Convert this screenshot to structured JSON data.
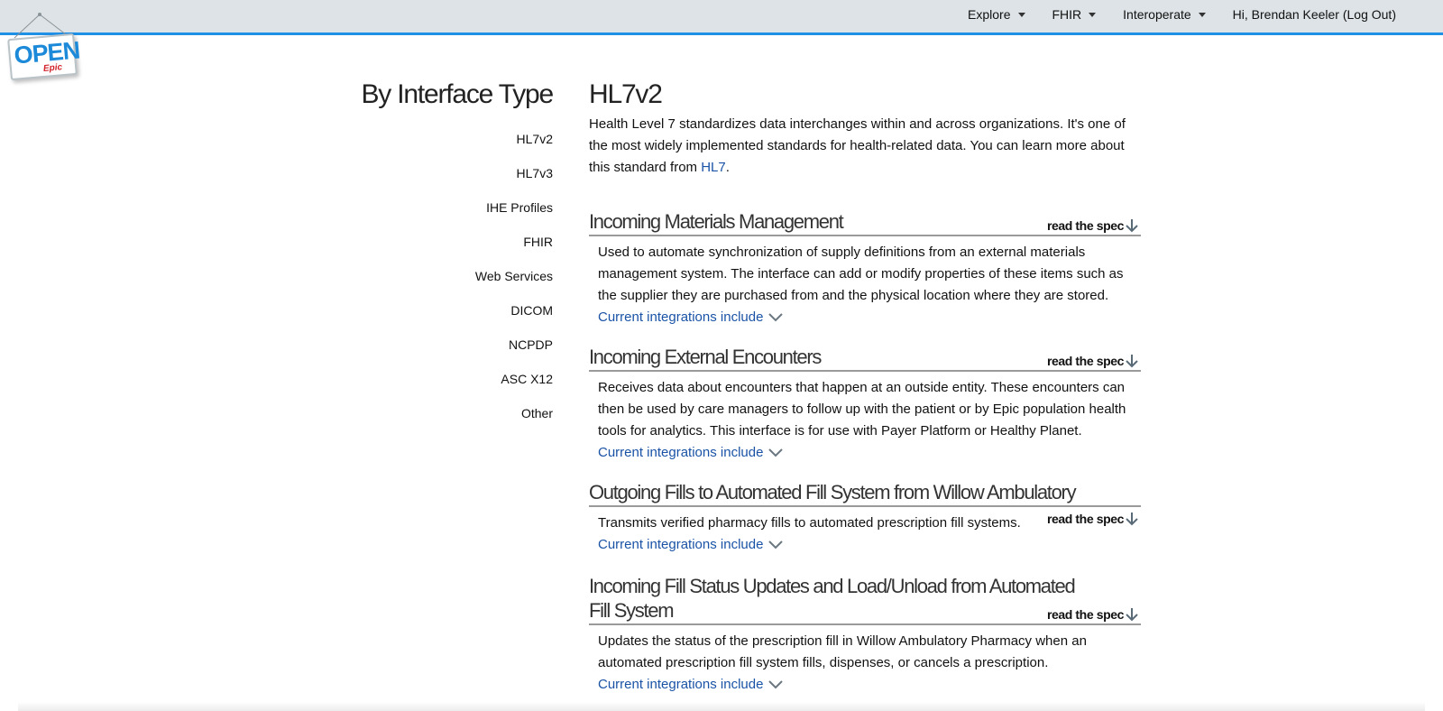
{
  "header": {
    "nav": [
      {
        "label": "Explore"
      },
      {
        "label": "FHIR"
      },
      {
        "label": "Interoperate"
      }
    ],
    "user_label": "Hi, Brendan Keeler (Log Out)"
  },
  "logo": {
    "open": "OPEN",
    "epic": "Epic"
  },
  "sidebar": {
    "title": "By Interface Type",
    "items": [
      {
        "label": "HL7v2"
      },
      {
        "label": "HL7v3"
      },
      {
        "label": "IHE Profiles"
      },
      {
        "label": "FHIR"
      },
      {
        "label": "Web Services"
      },
      {
        "label": "DICOM"
      },
      {
        "label": "NCPDP"
      },
      {
        "label": "ASC X12"
      },
      {
        "label": "Other"
      }
    ]
  },
  "main": {
    "title": "HL7v2",
    "intro_text": "Health Level 7 standardizes data interchanges within and across organizations. It's one of the most widely implemented standards for health-related data. You can learn more about this standard from ",
    "intro_link": "HL7",
    "intro_end": ".",
    "spec_label": "read the spec",
    "integrations_label": "Current integrations include",
    "sections": [
      {
        "title": "Incoming Materials Management",
        "description": "Used to automate synchronization of supply definitions from an external materials management system. The interface can add or modify properties of these items such as the supplier they are purchased from and the physical location where they are stored."
      },
      {
        "title": "Incoming External Encounters",
        "description": "Receives data about encounters that happen at an outside entity. These encounters can then be used by care managers to follow up with the patient or by Epic population health tools for analytics. This interface is for use with Payer Platform or Healthy Planet."
      },
      {
        "title": "Outgoing Fills to Automated Fill System from Willow Ambulatory",
        "description": "Transmits verified pharmacy fills to automated prescription fill systems."
      },
      {
        "title": "Incoming Fill Status Updates and Load/Unload from Automated Fill System",
        "description": "Updates the status of the prescription fill in Willow Ambulatory Pharmacy when an automated prescription fill system fills, dispenses, or cancels a prescription."
      }
    ]
  }
}
